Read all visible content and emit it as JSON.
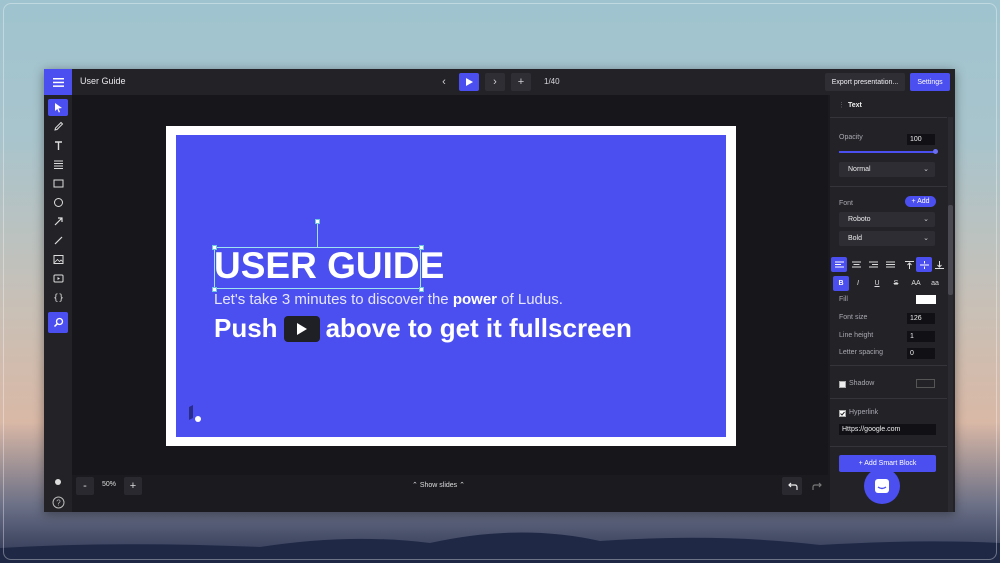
{
  "app": {
    "title": "User Guide"
  },
  "topbar": {
    "page_count": "1/40",
    "export_label": "Export presentation...",
    "settings_label": "Settings"
  },
  "slide": {
    "title": "USER GUIDE",
    "subtitle_pre": "Let's take 3 minutes to discover the ",
    "subtitle_bold": "power",
    "subtitle_post": " of Ludus.",
    "push_pre": "Push",
    "push_post": "above to get it fullscreen",
    "bg_color": "#4c4ff0"
  },
  "bottombar": {
    "zoom": "50%",
    "show_slides": "Show slides"
  },
  "panel": {
    "header": "Text",
    "opacity_label": "Opacity",
    "opacity_value": "100",
    "blend_mode": "Normal",
    "font_label": "Font",
    "add_label": "+ Add",
    "font_family": "Roboto",
    "font_weight": "Bold",
    "fill_label": "Fill",
    "font_size_label": "Font size",
    "font_size_value": "126",
    "line_height_label": "Line height",
    "line_height_value": "1",
    "letter_spacing_label": "Letter spacing",
    "letter_spacing_value": "0",
    "shadow_label": "Shadow",
    "hyperlink_label": "Hyperlink",
    "hyperlink_value": "Https://google.com",
    "smart_block_label": "+  Add Smart Block",
    "format_buttons": [
      "B",
      "I",
      "U",
      "S",
      "AA",
      "aa"
    ]
  },
  "colors": {
    "accent": "#4c4ff0",
    "background": "#1b1a1f"
  }
}
